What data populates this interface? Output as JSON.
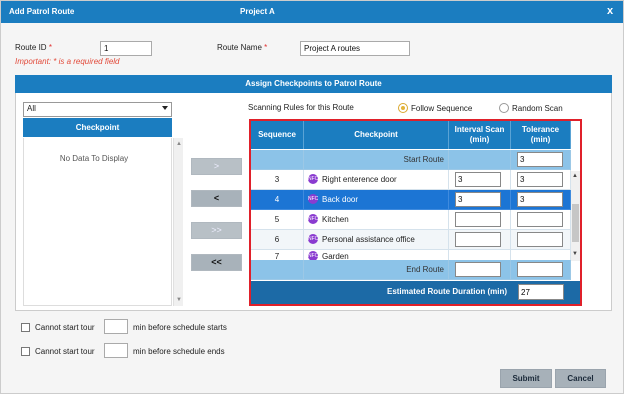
{
  "dialog": {
    "title": "Add Patrol Route",
    "project": "Project A",
    "close": "x"
  },
  "form": {
    "route_id_label": "Route ID",
    "route_id_value": "1",
    "route_name_label": "Route Name",
    "route_name_value": "Project A routes",
    "required_mark": "*",
    "important_note": "Important: * is a required field"
  },
  "section": {
    "title": "Assign Checkpoints to Patrol Route"
  },
  "available": {
    "filter_value": "All",
    "header": "Checkpoint",
    "empty_text": "No Data To Display"
  },
  "move_buttons": [
    ">",
    "<",
    ">>",
    "<<"
  ],
  "rules": {
    "label": "Scanning Rules for this Route",
    "options": [
      "Follow Sequence",
      "Random Scan"
    ],
    "selected": "Follow Sequence"
  },
  "grid": {
    "headers": {
      "sequence": "Sequence",
      "checkpoint": "Checkpoint",
      "interval_l1": "Interval Scan",
      "interval_l2": "(min)",
      "tolerance_l1": "Tolerance",
      "tolerance_l2": "(min)"
    },
    "start_label": "Start Route",
    "start_tolerance": "3",
    "rows": [
      {
        "seq": "3",
        "name": "Right enterence door",
        "interval": "3",
        "tolerance": "3"
      },
      {
        "seq": "4",
        "name": "Back door",
        "interval": "3",
        "tolerance": "3"
      },
      {
        "seq": "5",
        "name": "Kitchen",
        "interval": "",
        "tolerance": ""
      },
      {
        "seq": "6",
        "name": "Personal assistance office",
        "interval": "",
        "tolerance": ""
      },
      {
        "seq": "7",
        "name": "Garden",
        "interval": "",
        "tolerance": ""
      }
    ],
    "end_label": "End Route",
    "duration_label": "Estimated Route Duration (min)",
    "duration_value": "27",
    "nfc_icon_text": "NFC"
  },
  "options": {
    "start_prefix": "Cannot start tour",
    "start_suffix": "min before schedule starts",
    "end_prefix": "Cannot start tour",
    "end_suffix": "min before schedule ends"
  },
  "actions": {
    "submit": "Submit",
    "cancel": "Cancel"
  },
  "colors": {
    "header_blue": "#1b7dc0",
    "selected_row": "#1c75d4",
    "highlight_border": "#e0202a",
    "nfc_purple": "#8a3bd0"
  }
}
